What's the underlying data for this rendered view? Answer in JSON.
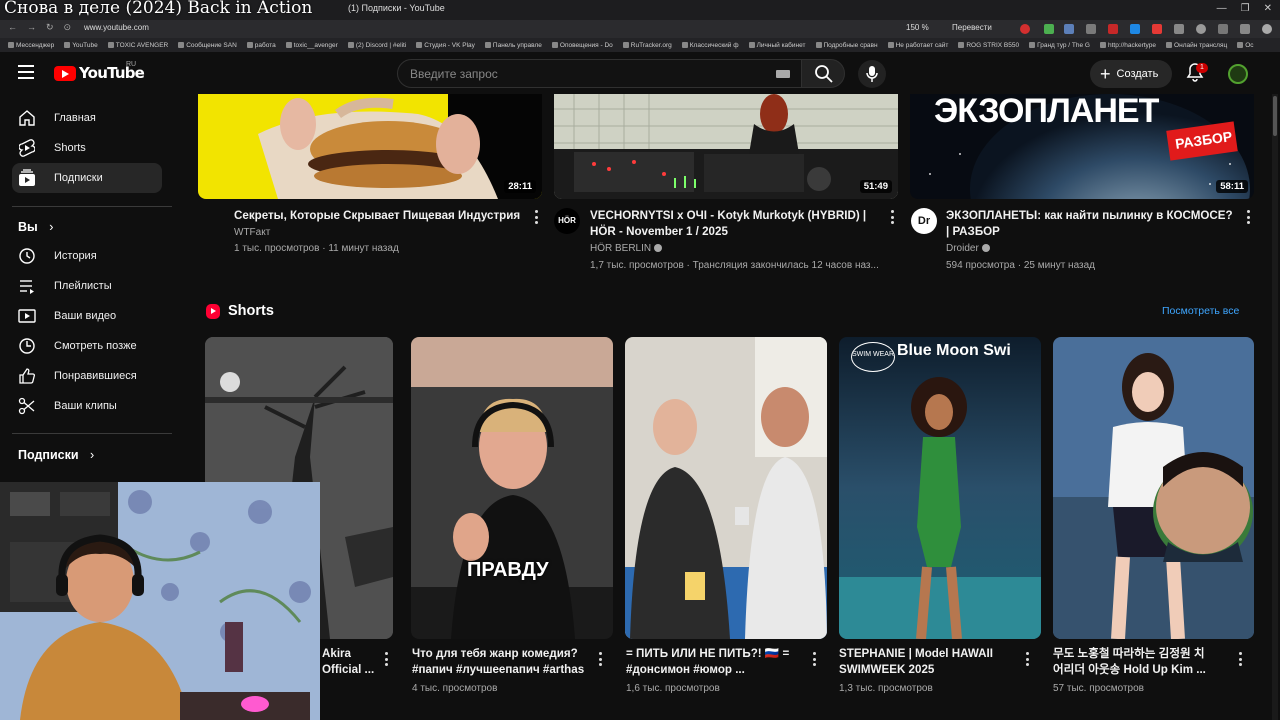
{
  "overlay_title": "Снова в деле (2024) Back in Action",
  "browser": {
    "tab_title": "(1) Подписки - YouTube",
    "url": "www.youtube.com",
    "zoom": "150 %",
    "translate_label": "Перевести",
    "bookmarks": [
      "Мессенджер",
      "YouTube",
      "TOXIC AVENGER",
      "Сообщение SAN",
      "работа",
      "toxic__avenger",
      "(2) Discord | #eliti",
      "Студия - VK Play",
      "Панель управле",
      "Оповещения - Do",
      "RuTracker.org",
      "Классический ф",
      "Личный кабинет",
      "Подробные сравн",
      "Не работает сайт",
      "ROG STRIX B550",
      "Гранд тур / The G",
      "http://hackertype",
      "Онлайн трансляц",
      "Ос"
    ]
  },
  "header": {
    "logo_text": "YouTube",
    "logo_region": "RU",
    "search_placeholder": "Введите запрос",
    "create_label": "Создать",
    "notifications_count": "1"
  },
  "sidebar": {
    "main_items": [
      {
        "label": "Главная",
        "icon": "home-icon"
      },
      {
        "label": "Shorts",
        "icon": "shorts-icon"
      },
      {
        "label": "Подписки",
        "icon": "subscriptions-icon",
        "active": true
      }
    ],
    "you_label": "Вы",
    "you_items": [
      {
        "label": "История",
        "icon": "history-icon"
      },
      {
        "label": "Плейлисты",
        "icon": "playlists-icon"
      },
      {
        "label": "Ваши видео",
        "icon": "your-videos-icon"
      },
      {
        "label": "Смотреть позже",
        "icon": "watch-later-icon"
      },
      {
        "label": "Понравившиеся",
        "icon": "liked-icon"
      },
      {
        "label": "Ваши клипы",
        "icon": "clips-icon"
      }
    ],
    "subscriptions_label": "Подписки"
  },
  "videos": [
    {
      "duration": "28:11",
      "title": "Секреты, Которые Скрывает Пищевая Индустрия",
      "channel": "WTFакт",
      "views": "1 тыс. просмотров",
      "age": "11 минут назад",
      "verified": false
    },
    {
      "duration": "51:49",
      "title": "VECHORNYTSI x ОЧІ - Kotyk Murkotyk (HYBRID) | HÖR - November 1 / 2025",
      "channel": "HÖR BERLIN",
      "channel_avatar_text": "HÖR",
      "views": "1,7 тыс. просмотров",
      "age": "Трансляция закончилась 12 часов наз...",
      "verified": true
    },
    {
      "duration": "58:11",
      "title": "ЭКЗОПЛАНЕТЫ: как найти пылинку в КОСМОСЕ? | РАЗБОР",
      "channel": "Droider",
      "channel_avatar_text": "Dr",
      "views": "594 просмотра",
      "age": "25 минут назад",
      "verified": true,
      "thumb_text": "ЭКЗОПЛАНЕТ",
      "thumb_badge": "РАЗБОР"
    }
  ],
  "shorts": {
    "section_title": "Shorts",
    "see_all": "Посмотреть все",
    "items": [
      {
        "title_line1": "Akira",
        "title_line2": "Official ...",
        "views": ""
      },
      {
        "title_line1": "Что для тебя жанр комедия?",
        "title_line2": "#папич #лучшеепапич #arthas",
        "views": "4 тыс. просмотров",
        "caption": "ПРАВДУ"
      },
      {
        "title_line1": "= ПИТЬ ИЛИ НЕ ПИТЬ?! 🇷🇺 =",
        "title_line2": "#донсимон  #юмор  ...",
        "views": "1,6 тыс. просмотров"
      },
      {
        "title_line1": "STEPHANIE | Model HAWAII",
        "title_line2": "SWIMWEEK 2025",
        "views": "1,3 тыс. просмотров",
        "thumb_text": "Blue Moon Swi",
        "thumb_logo": "SWIM WEAR"
      },
      {
        "title_line1": "무도 노홍철 따라하는 김정원 치",
        "title_line2": "어리더 아웃송 Hold Up Kim ...",
        "views": "57 тыс. просмотров"
      }
    ]
  },
  "colors": {
    "background": "#0f0f0f",
    "accent": "#ff0000",
    "link": "#3ea6ff",
    "text_secondary": "#aaaaaa"
  }
}
